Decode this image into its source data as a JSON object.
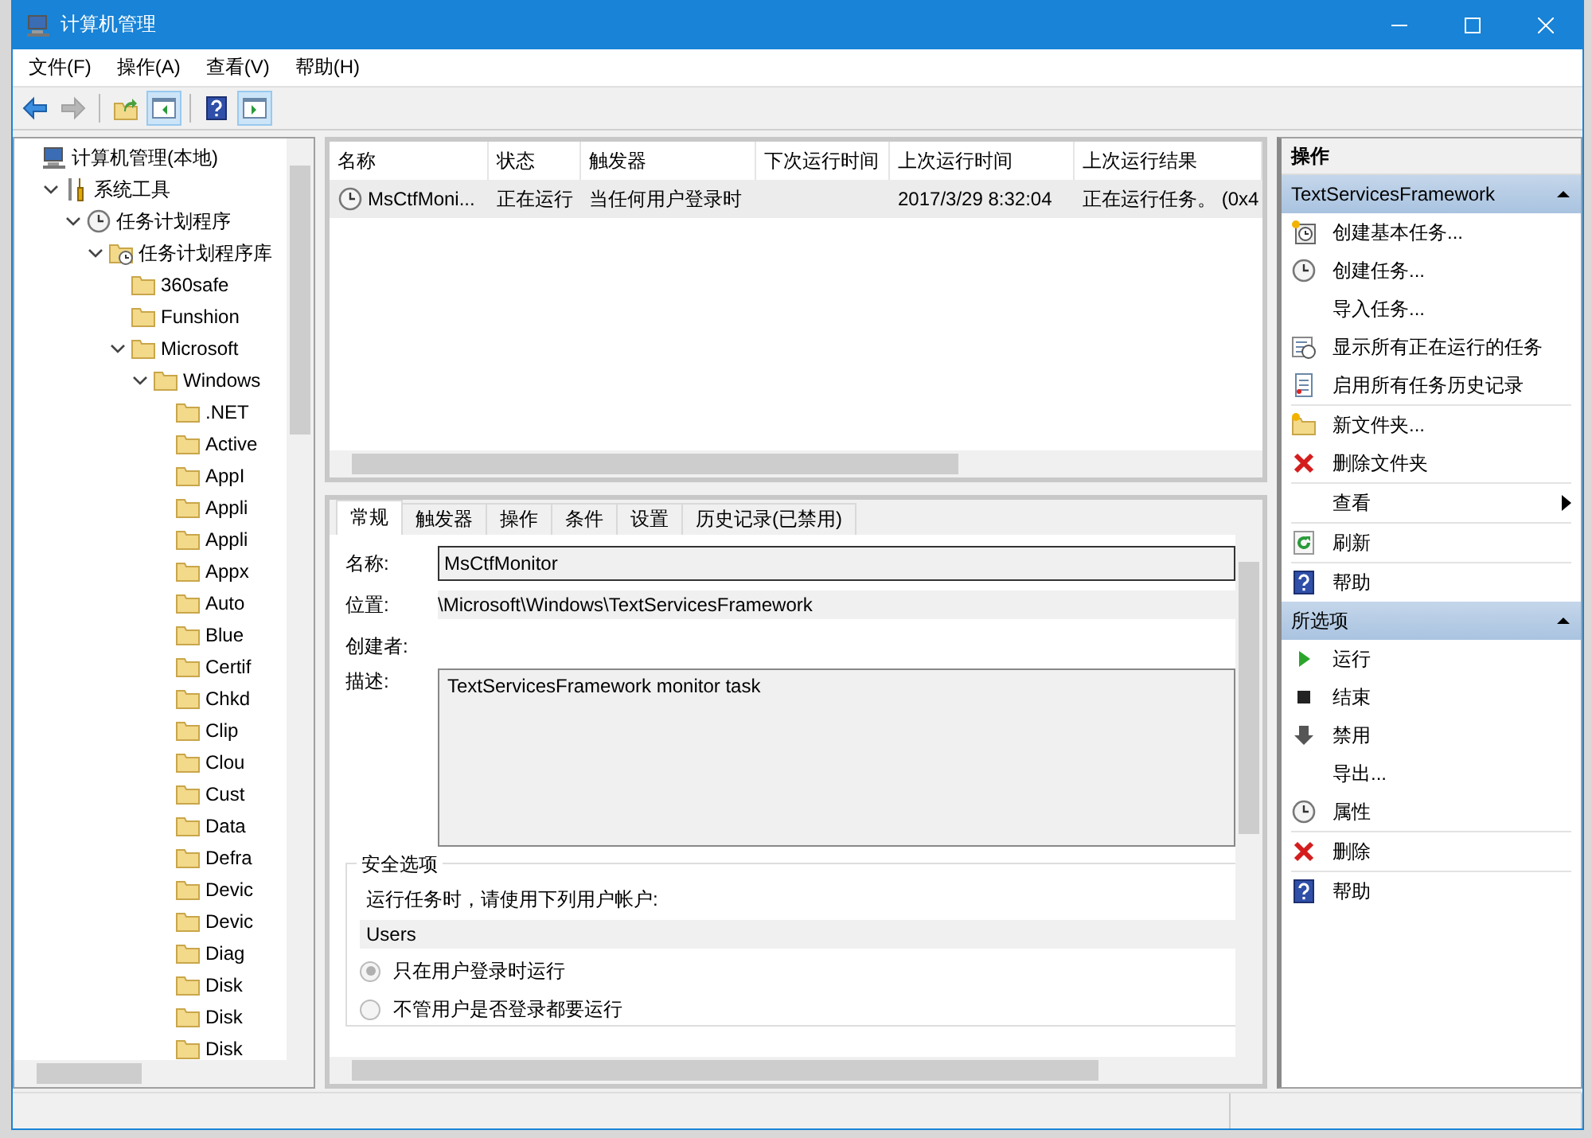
{
  "window": {
    "title": "计算机管理"
  },
  "menu": [
    "文件(F)",
    "操作(A)",
    "查看(V)",
    "帮助(H)"
  ],
  "toolbar": [
    {
      "pressed": false,
      "disabled": false
    },
    {
      "pressed": false,
      "disabled": true
    },
    {
      "pressed": false,
      "disabled": false
    },
    {
      "pressed": true,
      "disabled": false
    },
    {
      "pressed": false,
      "disabled": false
    },
    {
      "pressed": true,
      "disabled": false
    }
  ],
  "tree": {
    "label": "计算机管理(本地)",
    "children": [
      {
        "label": "系统工具",
        "expanded": true,
        "children": [
          {
            "label": "任务计划程序",
            "expanded": true,
            "children": [
              {
                "label": "任务计划程序库",
                "expanded": true,
                "children": [
                  {
                    "label": "360safe"
                  },
                  {
                    "label": "Funshion"
                  },
                  {
                    "label": "Microsoft",
                    "expanded": true,
                    "children": [
                      {
                        "label": "Windows",
                        "expanded": true,
                        "children": [
                          {
                            "label": ".NET"
                          },
                          {
                            "label": "Active"
                          },
                          {
                            "label": "AppI"
                          },
                          {
                            "label": "Appli"
                          },
                          {
                            "label": "Appli"
                          },
                          {
                            "label": "Appx"
                          },
                          {
                            "label": "Auto"
                          },
                          {
                            "label": "Blue"
                          },
                          {
                            "label": "Certif"
                          },
                          {
                            "label": "Chkd"
                          },
                          {
                            "label": "Clip"
                          },
                          {
                            "label": "Clou"
                          },
                          {
                            "label": "Cust"
                          },
                          {
                            "label": "Data"
                          },
                          {
                            "label": "Defra"
                          },
                          {
                            "label": "Devic"
                          },
                          {
                            "label": "Devic"
                          },
                          {
                            "label": "Diag"
                          },
                          {
                            "label": "Disk"
                          },
                          {
                            "label": "Disk"
                          },
                          {
                            "label": "Disk"
                          }
                        ]
                      }
                    ]
                  }
                ]
              }
            ]
          }
        ]
      }
    ]
  },
  "task_list": {
    "columns": [
      "名称",
      "状态",
      "触发器",
      "下次运行时间",
      "上次运行时间",
      "上次运行结果"
    ],
    "rows": [
      {
        "name": "MsCtfMoni...",
        "status": "正在运行",
        "trigger": "当任何用户登录时",
        "last_run": "2017/3/29 8:32:04",
        "last_result": "正在运行任务。 (0x4",
        "selected": true
      }
    ]
  },
  "details": {
    "tabs": [
      {
        "label": "常规",
        "selected": true
      },
      {
        "label": "触发器",
        "selected": false
      },
      {
        "label": "操作",
        "selected": false
      },
      {
        "label": "条件",
        "selected": false
      },
      {
        "label": "设置",
        "selected": false
      },
      {
        "label": "历史记录(已禁用)",
        "selected": false
      }
    ],
    "name_label": "名称:",
    "name_value": "MsCtfMonitor",
    "location_label": "位置:",
    "location_value": "\\Microsoft\\Windows\\TextServicesFramework",
    "author_label": "创建者:",
    "description_label": "描述:",
    "description_value": "TextServicesFramework monitor task",
    "security": {
      "title": "安全选项",
      "account_label": "运行任务时，请使用下列用户帐户:",
      "account": "Users",
      "options": [
        {
          "label": "只在用户登录时运行",
          "selected": true
        },
        {
          "label": "不管用户是否登录都要运行",
          "selected": false
        }
      ]
    }
  },
  "actions": {
    "title": "操作",
    "sections": [
      {
        "title": "TextServicesFramework",
        "expanded": true,
        "groups": [
          [
            {
              "label": "创建基本任务..."
            },
            {
              "label": "创建任务..."
            },
            {
              "label": "导入任务..."
            },
            {
              "label": "显示所有正在运行的任务"
            },
            {
              "label": "启用所有任务历史记录"
            }
          ],
          [
            {
              "label": "新文件夹..."
            },
            {
              "label": "删除文件夹"
            }
          ],
          [
            {
              "label": "查看",
              "submenu": true
            }
          ],
          [
            {
              "label": "刷新"
            }
          ],
          [
            {
              "label": "帮助"
            }
          ]
        ]
      },
      {
        "title": "所选项",
        "expanded": true,
        "groups": [
          [
            {
              "label": "运行"
            },
            {
              "label": "结束"
            },
            {
              "label": "禁用"
            },
            {
              "label": "导出..."
            },
            {
              "label": "属性"
            }
          ],
          [
            {
              "label": "删除"
            }
          ],
          [
            {
              "label": "帮助"
            }
          ]
        ]
      }
    ]
  }
}
